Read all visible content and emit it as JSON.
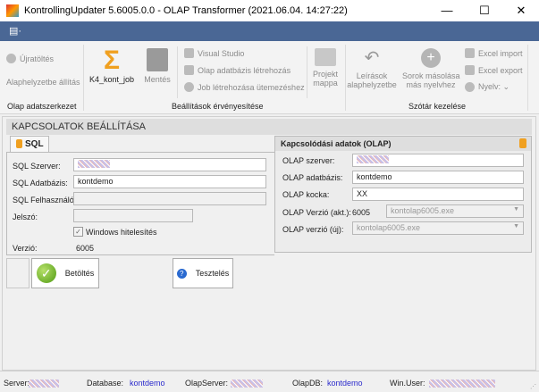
{
  "window": {
    "title": "KontrollingUpdater  5.6005.0.0 - OLAP Transformer  (2021.06.04. 14:27:22)",
    "minimize": "—",
    "maximize": "☐",
    "close": "✕"
  },
  "menubar": {
    "menu_icon": "▤·"
  },
  "ribbon": {
    "groups": [
      {
        "label": "Olap adatszerkezet"
      },
      {
        "label": "Beállítások érvényesítése"
      },
      {
        "label": "Szótár kezelése"
      }
    ],
    "ujratoltes": "Újratöltés",
    "alaphelyzet": "Alaphelyzetbe állítás",
    "k4": "K4_kont_job",
    "mentes": "Mentés",
    "visual_studio": "Visual Studio",
    "olap_letrehozas": "Olap adatbázis létrehozás",
    "job_letrehozas": "Job létrehozása ütemezéshez",
    "projekt1": "Projekt",
    "projekt2": "mappa",
    "leirasok1": "Leírások",
    "leirasok2": "alaphelyzetbe",
    "sorok1": "Sorok másolása",
    "sorok2": "más nyelvhez",
    "excel_import": "Excel import",
    "excel_export": "Excel export",
    "nyelv": "Nyelv: ⌄"
  },
  "main": {
    "header": "KAPCSOLATOK BEÁLLÍTÁSA",
    "sql_tab": "SQL",
    "sql": {
      "server_label": "SQL Szerver:",
      "db_label": "SQL Adatbázis:",
      "db_value": "kontdemo",
      "user_label": "SQL Felhasználó:",
      "pwd_label": "Jelszó:",
      "win_auth": "Windows hitelesítés",
      "version_label": "Verzió:",
      "version_value": "6005"
    },
    "olap": {
      "title": "Kapcsolódási adatok (OLAP)",
      "server_label": "OLAP szerver:",
      "db_label": "OLAP adatbázis:",
      "db_value": "kontdemo",
      "cube_label": "OLAP kocka:",
      "cube_value": "XX",
      "ver_akt_label": "OLAP Verzió (akt.):",
      "ver_akt_value": "6005",
      "ver_akt_select": "kontolap6005.exe",
      "ver_new_label": "OLAP verzió (új):",
      "ver_new_select": "kontolap6005.exe"
    },
    "betoltes": "Betöltés",
    "teszteles": "Tesztelés"
  },
  "status": {
    "server": "Server:",
    "database": "Database:",
    "database_value": "kontdemo",
    "olapserver": "OlapServer:",
    "olapdb": "OlapDB:",
    "olapdb_value": "kontdemo",
    "winuser": "Win.User:"
  }
}
